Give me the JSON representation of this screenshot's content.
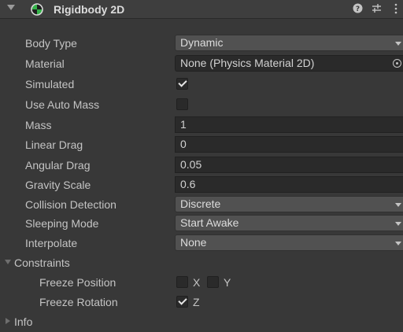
{
  "header": {
    "title": "Rigidbody 2D",
    "help_icon": "help-icon",
    "presets_icon": "presets-icon",
    "menu_icon": "kebab-menu-icon"
  },
  "fields": {
    "body_type": {
      "label": "Body Type",
      "value": "Dynamic"
    },
    "material": {
      "label": "Material",
      "value": "None (Physics Material 2D)"
    },
    "simulated": {
      "label": "Simulated",
      "checked": true
    },
    "use_auto_mass": {
      "label": "Use Auto Mass",
      "checked": false
    },
    "mass": {
      "label": "Mass",
      "value": "1"
    },
    "linear_drag": {
      "label": "Linear Drag",
      "value": "0"
    },
    "angular_drag": {
      "label": "Angular Drag",
      "value": "0.05"
    },
    "gravity_scale": {
      "label": "Gravity Scale",
      "value": "0.6"
    },
    "collision_detection": {
      "label": "Collision Detection",
      "value": "Discrete"
    },
    "sleeping_mode": {
      "label": "Sleeping Mode",
      "value": "Start Awake"
    },
    "interpolate": {
      "label": "Interpolate",
      "value": "None"
    }
  },
  "constraints": {
    "label": "Constraints",
    "freeze_position": {
      "label": "Freeze Position",
      "x_label": "X",
      "x_checked": false,
      "y_label": "Y",
      "y_checked": false
    },
    "freeze_rotation": {
      "label": "Freeze Rotation",
      "z_label": "Z",
      "z_checked": true
    }
  },
  "info": {
    "label": "Info"
  },
  "colors": {
    "background": "#383838",
    "field_bg": "#2a2a2a",
    "dropdown_bg": "#515151",
    "icon_green": "#35b34a"
  }
}
